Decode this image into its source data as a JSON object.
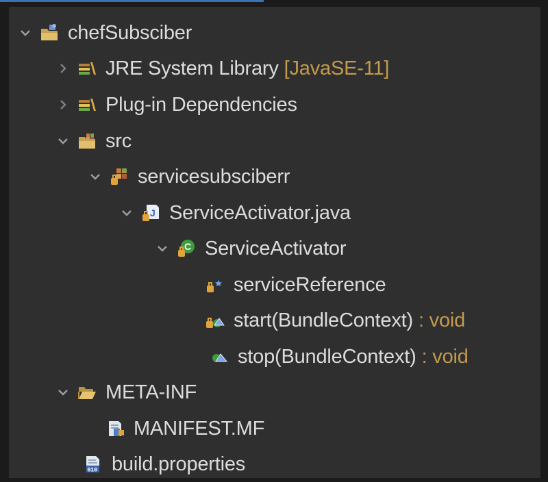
{
  "tree": {
    "project": {
      "label": "chefSubsciber"
    },
    "jre": {
      "label": "JRE System Library",
      "decoration": "[JavaSE-11]"
    },
    "plugin_deps": {
      "label": "Plug-in Dependencies"
    },
    "src": {
      "label": "src"
    },
    "package": {
      "label": "servicesubsciberr"
    },
    "java_file": {
      "label": "ServiceActivator.java"
    },
    "class": {
      "label": "ServiceActivator"
    },
    "field": {
      "label": "serviceReference"
    },
    "method_start": {
      "label": "start(BundleContext)",
      "decoration": ": void"
    },
    "method_stop": {
      "label": "stop(BundleContext)",
      "decoration": ": void"
    },
    "meta_inf": {
      "label": "META-INF"
    },
    "manifest": {
      "label": "MANIFEST.MF"
    },
    "build_properties": {
      "label": "build.properties"
    }
  },
  "colors": {
    "background": "#2f2f2f",
    "text": "#dcdcdc",
    "decoration": "#c49a4c",
    "twistie": "#9aa0a6"
  }
}
